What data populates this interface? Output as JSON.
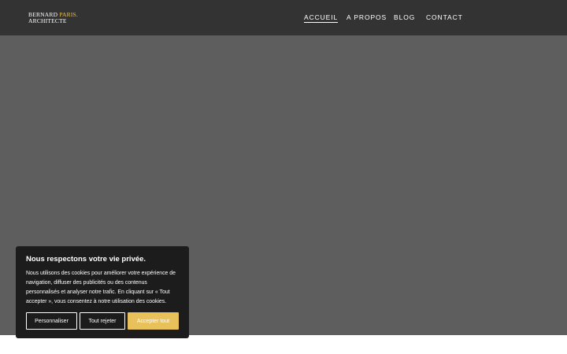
{
  "header": {
    "logo": {
      "line1_main": "BERNARD",
      "line1_accent": "PARIS.",
      "line2": "ARCHITECTE"
    },
    "nav": [
      {
        "label": "ACCUEIL"
      },
      {
        "label": "A PROPOS"
      },
      {
        "label": "BLOG"
      },
      {
        "label": "CONTACT"
      }
    ]
  },
  "cookie_banner": {
    "title": "Nous respectons votre vie privée.",
    "text": "Nous utilisons des cookies pour améliorer votre expérience de navigation, diffuser des publicités ou des contenus personnalisés et analyser notre trafic. En cliquant sur « Tout accepter », vous consentez à notre utilisation des cookies.",
    "buttons": {
      "customize": "Personnaliser",
      "reject": "Tout rejeter",
      "accept": "Accepter tout"
    }
  },
  "colors": {
    "header_bg": "#333333",
    "hero_bg": "#5e5e5e",
    "banner_bg": "#1c1c1c",
    "accent": "#e8c15a"
  }
}
